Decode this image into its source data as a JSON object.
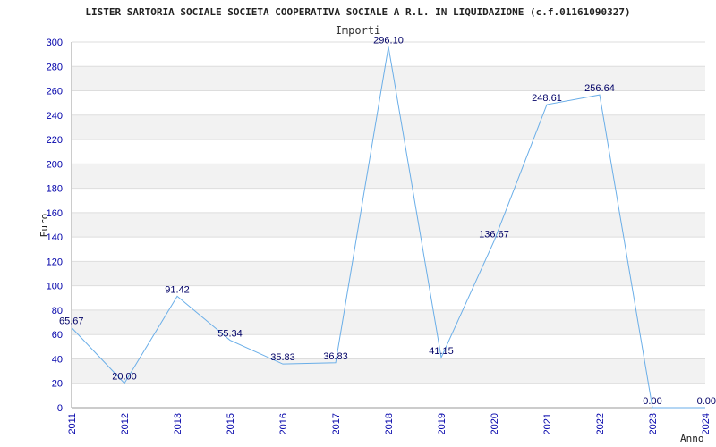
{
  "chart_data": {
    "type": "line",
    "title": "LISTER SARTORIA SOCIALE SOCIETA COOPERATIVA SOCIALE A R.L. IN LIQUIDAZIONE (c.f.01161090327)",
    "subtitle": "Importi",
    "xlabel": "Anno",
    "ylabel": "Euro",
    "categories": [
      "2011",
      "2012",
      "2013",
      "2015",
      "2016",
      "2017",
      "2018",
      "2019",
      "2020",
      "2021",
      "2022",
      "2023",
      "2024"
    ],
    "series": [
      {
        "values": [
          65.67,
          20.0,
          91.42,
          55.34,
          35.83,
          36.83,
          296.1,
          41.15,
          136.67,
          248.61,
          256.64,
          0.0,
          0.0
        ],
        "labels": [
          "65.67",
          "20.00",
          "91.42",
          "55.34",
          "35.83",
          "36.83",
          "296.10",
          "41.15",
          "136.67",
          "248.61",
          "256.64",
          "0.00",
          "0.00"
        ]
      }
    ],
    "ylim": [
      0,
      300
    ],
    "yticks": [
      "0",
      "20",
      "40",
      "60",
      "80",
      "100",
      "120",
      "140",
      "160",
      "180",
      "200",
      "220",
      "240",
      "260",
      "280",
      "300"
    ],
    "grid": true,
    "colors": {
      "line": "#6aaee8",
      "band": "#f2f2f2",
      "grid": "#dddddd",
      "ticks": "#0000aa",
      "labels": "#000066"
    }
  }
}
